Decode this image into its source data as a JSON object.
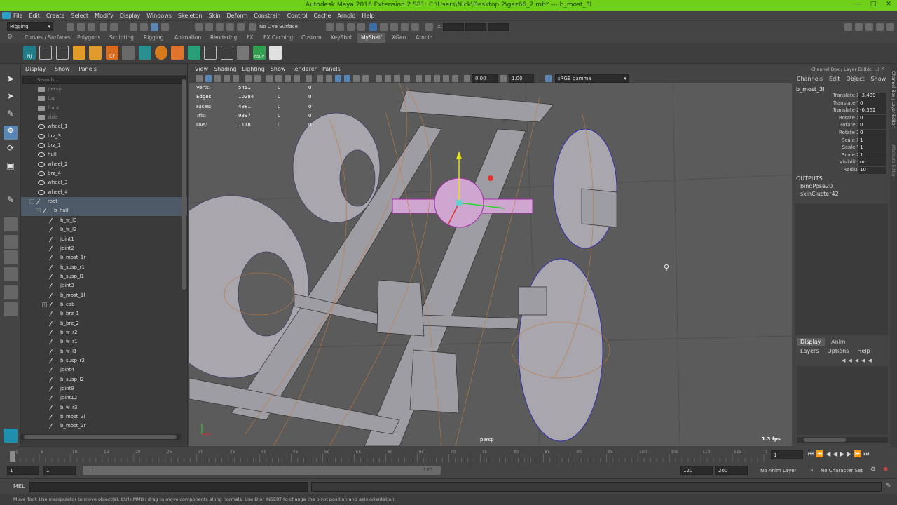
{
  "window": {
    "title": "Autodesk Maya 2016 Extension 2 SP1: C:\\Users\\Nick\\Desktop 2\\gaz66_2.mb*   ---   b_most_3l",
    "controls": [
      "minimize",
      "maximize",
      "close"
    ]
  },
  "menubar": [
    "File",
    "Edit",
    "Create",
    "Select",
    "Modify",
    "Display",
    "Windows",
    "Skeleton",
    "Skin",
    "Deform",
    "Constrain",
    "Control",
    "Cache",
    "Arnold",
    "Help"
  ],
  "statusline": {
    "mode": "Rigging",
    "live_surface": "No Live Surface",
    "coord_labels": [
      "X:",
      "Y:",
      "Z:"
    ]
  },
  "shelf_tabs": [
    "Curves / Surfaces",
    "Polygons",
    "Sculpting",
    "Rigging",
    "Animation",
    "Rendering",
    "FX",
    "FX Caching",
    "Custom",
    "KeyShot",
    "MyShelf",
    "XGen",
    "Arnold"
  ],
  "shelf_active": "MyShelf",
  "shelf_labels": [
    "NJ",
    "CF",
    "NSUV"
  ],
  "outliner": {
    "menu": [
      "Display",
      "Show",
      "Panels"
    ],
    "search_placeholder": "Search...",
    "items": [
      {
        "label": "persp",
        "type": "cam",
        "indent": 0,
        "dim": true
      },
      {
        "label": "top",
        "type": "cam",
        "indent": 0,
        "dim": true
      },
      {
        "label": "front",
        "type": "cam",
        "indent": 0,
        "dim": true
      },
      {
        "label": "side",
        "type": "cam",
        "indent": 0,
        "dim": true
      },
      {
        "label": "wheel_1",
        "type": "mesh",
        "indent": 0
      },
      {
        "label": "brz_3",
        "type": "mesh",
        "indent": 0
      },
      {
        "label": "brz_1",
        "type": "mesh",
        "indent": 0
      },
      {
        "label": "hull",
        "type": "mesh",
        "indent": 0
      },
      {
        "label": "wheel_2",
        "type": "mesh",
        "indent": 0
      },
      {
        "label": "brz_4",
        "type": "mesh",
        "indent": 0
      },
      {
        "label": "wheel_3",
        "type": "mesh",
        "indent": 0
      },
      {
        "label": "wheel_4",
        "type": "mesh",
        "indent": 0
      },
      {
        "label": "root",
        "type": "joint",
        "indent": 0,
        "expander": "-",
        "sel": true
      },
      {
        "label": "b_hull",
        "type": "joint",
        "indent": 1,
        "expander": "-",
        "sel": true
      },
      {
        "label": "b_w_l3",
        "type": "joint",
        "indent": 2
      },
      {
        "label": "b_w_l2",
        "type": "joint",
        "indent": 2
      },
      {
        "label": "joint1",
        "type": "joint",
        "indent": 2
      },
      {
        "label": "joint2",
        "type": "joint",
        "indent": 2
      },
      {
        "label": "b_most_1r",
        "type": "joint",
        "indent": 2
      },
      {
        "label": "b_susp_r1",
        "type": "joint",
        "indent": 2
      },
      {
        "label": "b_susp_l1",
        "type": "joint",
        "indent": 2
      },
      {
        "label": "joint3",
        "type": "joint",
        "indent": 2
      },
      {
        "label": "b_most_1l",
        "type": "joint",
        "indent": 2
      },
      {
        "label": "b_cab",
        "type": "joint",
        "indent": 2,
        "expander": "+"
      },
      {
        "label": "b_brz_1",
        "type": "joint",
        "indent": 2
      },
      {
        "label": "b_brz_2",
        "type": "joint",
        "indent": 2
      },
      {
        "label": "b_w_r2",
        "type": "joint",
        "indent": 2
      },
      {
        "label": "b_w_r1",
        "type": "joint",
        "indent": 2
      },
      {
        "label": "b_w_l1",
        "type": "joint",
        "indent": 2
      },
      {
        "label": "b_susp_r2",
        "type": "joint",
        "indent": 2
      },
      {
        "label": "joint4",
        "type": "joint",
        "indent": 2
      },
      {
        "label": "b_susp_l2",
        "type": "joint",
        "indent": 2
      },
      {
        "label": "joint9",
        "type": "joint",
        "indent": 2
      },
      {
        "label": "joint12",
        "type": "joint",
        "indent": 2
      },
      {
        "label": "b_w_r3",
        "type": "joint",
        "indent": 2
      },
      {
        "label": "b_most_2l",
        "type": "joint",
        "indent": 2
      },
      {
        "label": "b_most_2r",
        "type": "joint",
        "indent": 2
      }
    ]
  },
  "viewport": {
    "menu": [
      "View",
      "Shading",
      "Lighting",
      "Show",
      "Renderer",
      "Panels"
    ],
    "field_a": "0.00",
    "field_b": "1.00",
    "colorspace": "sRGB gamma",
    "hud": [
      {
        "label": "Verts:",
        "a": "5451",
        "b": "0",
        "c": "0"
      },
      {
        "label": "Edges:",
        "a": "10284",
        "b": "0",
        "c": "0"
      },
      {
        "label": "Faces:",
        "a": "4881",
        "b": "0",
        "c": "0"
      },
      {
        "label": "Tris:",
        "a": "9397",
        "b": "0",
        "c": "0"
      },
      {
        "label": "UVs:",
        "a": "1118",
        "b": "0",
        "c": "0"
      }
    ],
    "camera_label": "persp",
    "fps": "1.3 fps"
  },
  "channelbox": {
    "title": "Channel Box / Layer Editor",
    "menu": [
      "Channels",
      "Edit",
      "Object",
      "Show"
    ],
    "object": "b_most_3l",
    "channels": [
      {
        "name": "Translate X",
        "value": "-3.489"
      },
      {
        "name": "Translate Y",
        "value": "0"
      },
      {
        "name": "Translate Z",
        "value": "-0.362"
      },
      {
        "name": "Rotate X",
        "value": "0"
      },
      {
        "name": "Rotate Y",
        "value": "0"
      },
      {
        "name": "Rotate Z",
        "value": "0"
      },
      {
        "name": "Scale X",
        "value": "1"
      },
      {
        "name": "Scale Y",
        "value": "1"
      },
      {
        "name": "Scale Z",
        "value": "1"
      },
      {
        "name": "Visibility",
        "value": "on"
      },
      {
        "name": "Radius",
        "value": "10"
      }
    ],
    "outputs_label": "OUTPUTS",
    "outputs": [
      "bindPose20",
      "skinCluster42"
    ],
    "layer_tabs": [
      "Display",
      "Anim"
    ],
    "layer_menu": [
      "Layers",
      "Options",
      "Help"
    ],
    "side_tabs": [
      "Channel Box / Layer Editor",
      "Attribute Editor"
    ]
  },
  "timeline": {
    "ticks": [
      "1",
      "5",
      "10",
      "15",
      "20",
      "25",
      "30",
      "35",
      "40",
      "45",
      "50",
      "55",
      "60",
      "65",
      "70",
      "75",
      "80",
      "85",
      "90",
      "95",
      "100",
      "105",
      "110",
      "115",
      "120"
    ],
    "current_frame": "1"
  },
  "range": {
    "start": "1",
    "inner_start": "1",
    "slider_start": "1",
    "slider_end": "120",
    "end": "120",
    "anim_end": "200",
    "anim_layer": "No Anim Layer",
    "char_set": "No Character Set"
  },
  "cmdline": {
    "label": "MEL"
  },
  "helpline": {
    "text": "Move Tool: Use manipulator to move object(s). Ctrl+MMB+drag to move components along normals. Use D or INSERT to change the pivot position and axis orientation."
  }
}
